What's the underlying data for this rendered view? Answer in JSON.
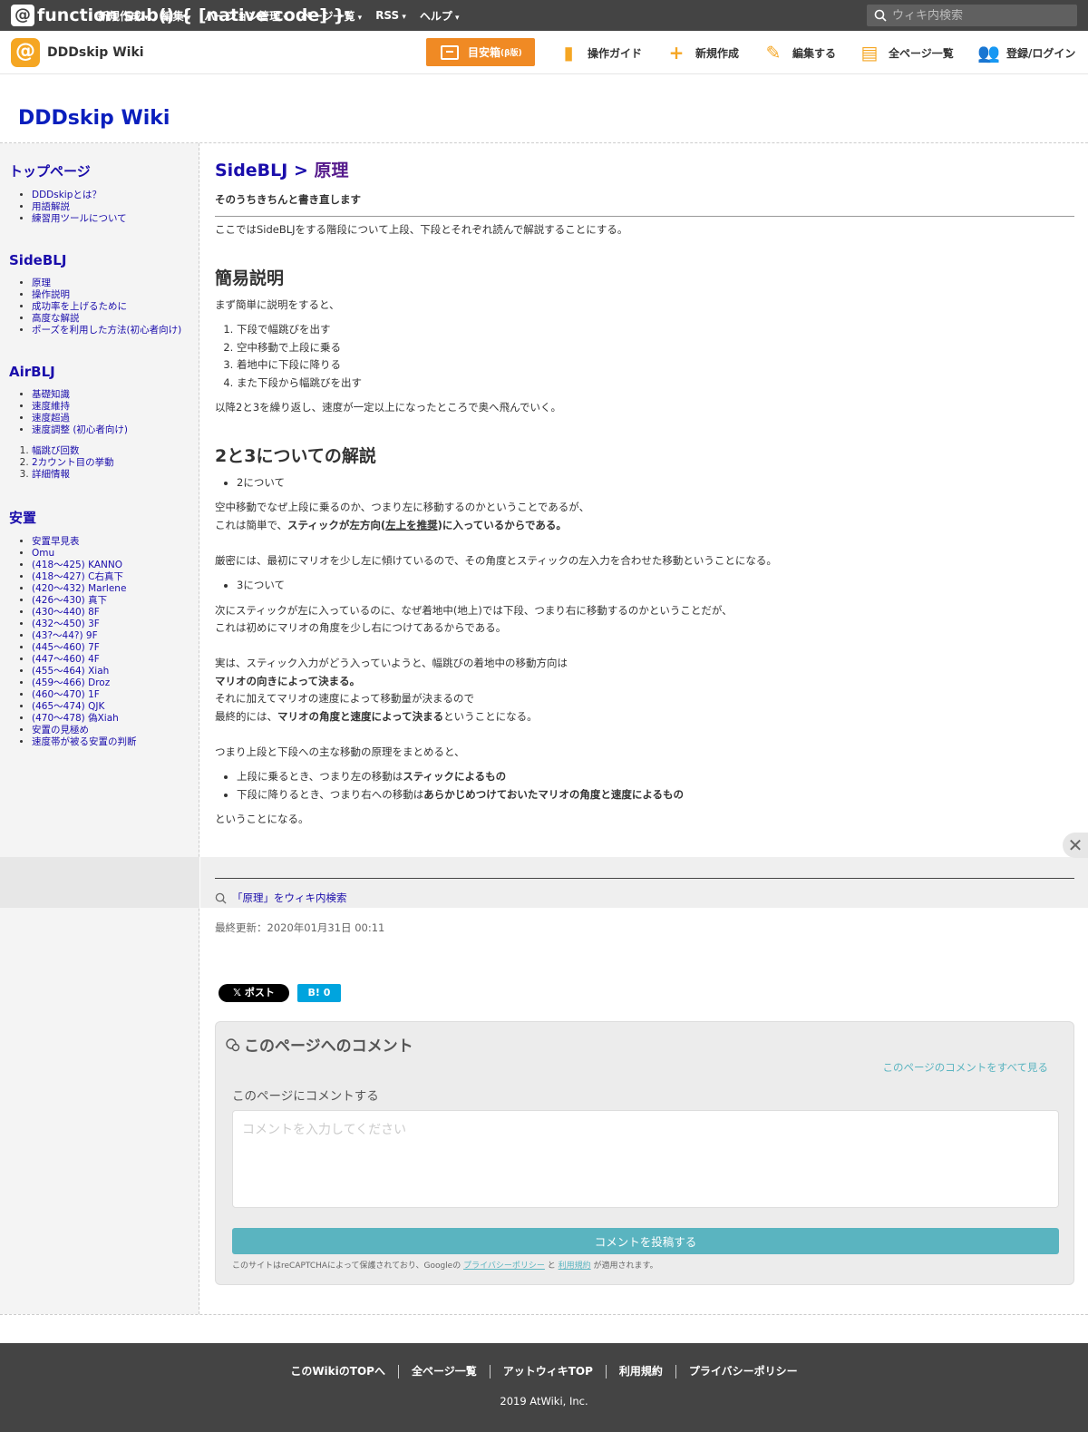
{
  "topbar": {
    "logo": "@WIKI!",
    "menu": [
      "新規作成",
      "編集",
      "バージョン管理",
      "ページ一覧",
      "RSS",
      "ヘルプ"
    ],
    "search_placeholder": "ウィキ内検索"
  },
  "subbar": {
    "site_name": "DDDskip Wiki",
    "mokuji": "目安箱",
    "mokuji_small": "(β版)",
    "tools": [
      "操作ガイド",
      "新規作成",
      "編集する",
      "全ページ一覧",
      "登録/ログイン"
    ]
  },
  "wiki_title": "DDDskip Wiki",
  "sidebar": {
    "top": {
      "title": "トップページ",
      "items": [
        "DDDskipとは？",
        "用語解説",
        "練習用ツールについて"
      ]
    },
    "sideblj": {
      "title": "SideBLJ",
      "items": [
        "原理",
        "操作説明",
        "成功率を上げるために",
        "高度な解説",
        "ポーズを利用した方法(初心者向け)"
      ]
    },
    "airblj": {
      "title": "AirBLJ",
      "items": [
        "基礎知識",
        "速度維持",
        "速度超過",
        "速度調整 (初心者向け)"
      ],
      "ol": [
        "幅跳び回数",
        "2カウント目の挙動",
        "詳細情報"
      ]
    },
    "anchi": {
      "title": "安置",
      "items": [
        "安置早見表",
        "Omu",
        "(418～425) KANNO",
        "(418～427) C右真下",
        "(420～432) Marlene",
        "(426～430) 真下",
        "(430～440) 8F",
        "(432～450) 3F",
        "(43?～44?) 9F",
        "(445～460) 7F",
        "(447～460) 4F",
        "(455～464) Xiah",
        "(459～466) Droz",
        "(460～470) 1F",
        "(465～474) QJK",
        "(470～478) 偽Xiah",
        "安置の見極め",
        "速度帯が被る安置の判断"
      ]
    }
  },
  "main": {
    "crumb_parent": "SideBLJ",
    "crumb_sep": " > ",
    "crumb_current": "原理",
    "subtitle": "そのうちきちんと書き直します",
    "intro": "ここではSideBLJをする階段について上段、下段とそれぞれ読んで解説することにする。",
    "h_simple": "簡易説明",
    "simple_lead": "まず簡単に説明をすると、",
    "steps": [
      "下段で幅跳びを出す",
      "空中移動で上段に乗る",
      "着地中に下段に降りる",
      "また下段から幅跳びを出す"
    ],
    "simple_after": "以降2と3を繰り返し、速度が一定以上になったところで奥へ飛んでいく。",
    "h_23": "2と3についての解説",
    "b2": "2について",
    "p2a": "空中移動でなぜ上段に乗るのか、つまり左に移動するのかということであるが、",
    "p2b_pre": "これは簡単で、",
    "p2b_bold1": "スティックが左方向(",
    "p2b_ul": "左上を推奨",
    "p2b_bold2": ")に入っているからである。",
    "p2c": "厳密には、最初にマリオを少し左に傾けているので、その角度とスティックの左入力を合わせた移動ということになる。",
    "b3": "3について",
    "p3a": "次にスティックが左に入っているのに、なぜ着地中(地上)では下段、つまり右に移動するのかということだが、",
    "p3b": "これは初めにマリオの角度を少し右につけてあるからである。",
    "p3c": "実は、スティック入力がどう入っていようと、幅跳びの着地中の移動方向は",
    "p3d": "マリオの向きによって決まる。",
    "p3e": "それに加えてマリオの速度によって移動量が決まるので",
    "p3f_pre": "最終的には、",
    "p3f_bold": "マリオの角度と速度によって決まる",
    "p3f_post": "ということになる。",
    "p4": "つまり上段と下段への主な移動の原理をまとめると、",
    "s1_pre": "上段に乗るとき、つまり左の移動は",
    "s1_bold": "スティックによるもの",
    "s2_pre": "下段に降りるとき、つまり右への移動は",
    "s2_bold": "あらかじめつけておいたマリオの角度と速度によるもの",
    "p5": "ということになる。"
  },
  "wiki_search": "「原理」をウィキ内検索",
  "updated": "最終更新：2020年01月31日 00:11",
  "share": {
    "x": "𝕏 ポスト",
    "hatena": "B! 0"
  },
  "comment": {
    "title": "このページへのコメント",
    "see_all": "このページのコメントをすべて見る",
    "label": "このページにコメントする",
    "placeholder": "コメントを入力してください",
    "submit": "コメントを投稿する",
    "rc_pre": "このサイトはreCAPTCHAによって保護されており、Googleの ",
    "rc_link1": "プライバシーポリシー",
    "rc_mid": " と ",
    "rc_link2": "利用規約",
    "rc_post": " が適用されます。"
  },
  "footer": {
    "links": [
      "このWikiのTOPへ",
      "全ページ一覧",
      "アットウィキTOP",
      "利用規約",
      "プライバシーポリシー"
    ],
    "copyright": "2019 AtWiki, Inc."
  },
  "colors": {
    "topbar": "#444444",
    "accent": "#f08a24",
    "link": "#1a0dab",
    "comment_button": "#5ab4c0"
  }
}
